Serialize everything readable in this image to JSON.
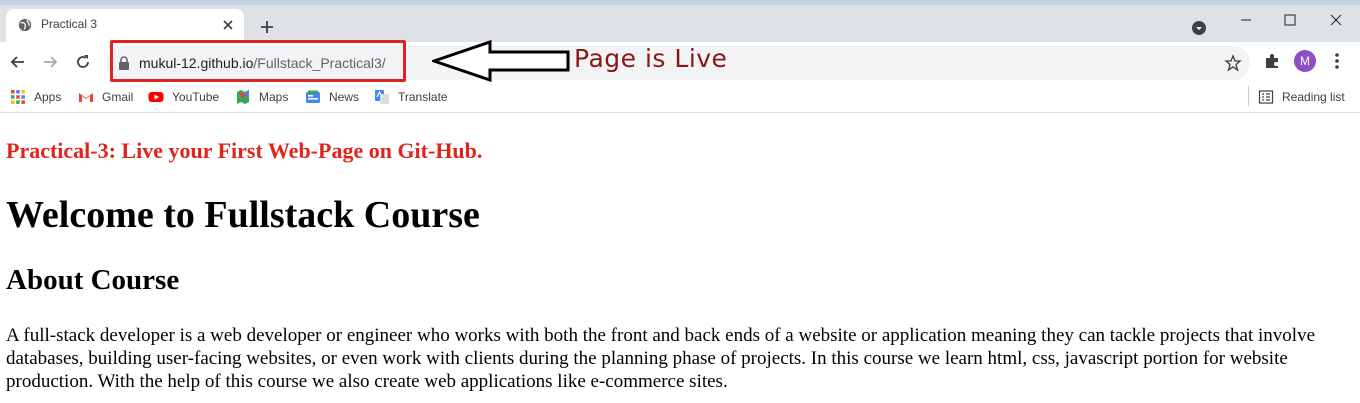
{
  "browser": {
    "tab_title": "Practical 3",
    "url_host": "mukul-12.github.io",
    "url_path": "/Fullstack_Practical3/",
    "profile_initial": "M",
    "bookmarks": [
      {
        "label": "Apps",
        "icon": "apps-grid-icon"
      },
      {
        "label": "Gmail",
        "icon": "gmail-icon"
      },
      {
        "label": "YouTube",
        "icon": "youtube-icon"
      },
      {
        "label": "Maps",
        "icon": "maps-icon"
      },
      {
        "label": "News",
        "icon": "news-icon"
      },
      {
        "label": "Translate",
        "icon": "translate-icon"
      }
    ],
    "reading_list": "Reading list"
  },
  "annotation": {
    "text": "Page is Live",
    "box_color": "#e0231e",
    "text_color": "#8a1717"
  },
  "page": {
    "red_heading": "Practical-3: Live your First Web-Page on Git-Hub.",
    "h1": "Welcome to Fullstack Course",
    "h2": "About Course",
    "paragraph": "A full-stack developer is a web developer or engineer who works with both the front and back ends of a website or application meaning they can tackle projects that involve databases, building user-facing websites, or even work with clients during the planning phase of projects. In this course we learn html, css, javascript portion for website production. With the help of this course we also create web applications like e-commerce sites."
  }
}
